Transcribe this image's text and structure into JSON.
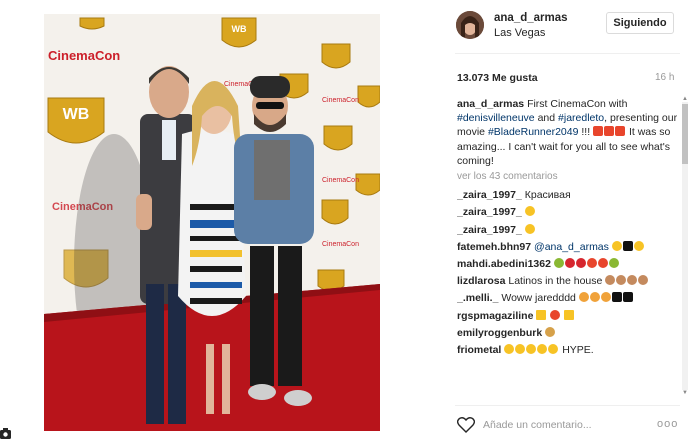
{
  "post": {
    "username": "ana_d_armas",
    "location": "Las Vegas",
    "follow_label": "Siguiendo",
    "likes": "13.073 Me gusta",
    "age": "16 h",
    "caption_user": "ana_d_armas",
    "caption_parts": {
      "p1": "First CinemaCon with",
      "tag1": "#denisvilleneuve",
      "p2": "and",
      "tag2": "#jaredleto",
      "p3": ", presenting our movie",
      "tag3": "#BladeRunner2049",
      "p4": "!!!",
      "p5": "It was so amazing... I can't wait for you all to see what's coming!"
    },
    "view_comments": "ver los 43 comentarios",
    "add_comment_placeholder": "Añade un comentario...",
    "more_options": "ooo"
  },
  "comments": [
    {
      "user": "_zaira_1997_",
      "text": "Красивая"
    },
    {
      "user": "_zaira_1997_",
      "text": ""
    },
    {
      "user": "_zaira_1997_",
      "text": ""
    },
    {
      "user": "fatemeh.bhn97",
      "mention": "@ana_d_armas",
      "text": ""
    },
    {
      "user": "mahdi.abedini1362",
      "text": ""
    },
    {
      "user": "lizdlarosa",
      "text": "Latinos in the house"
    },
    {
      "user": "_.melli._",
      "text": "Woww jaredddd"
    },
    {
      "user": "rgspmagaziline",
      "text": ""
    },
    {
      "user": "emilyroggenburk",
      "text": ""
    },
    {
      "user": "friometal",
      "text": "HYPE."
    }
  ],
  "photo": {
    "backdrop_brand": "CinemaCon",
    "logo_text": "WB",
    "backdrop_small": "CinemaCon"
  },
  "colors": {
    "link": "#003569",
    "muted": "#999999",
    "gold": "#d9a520",
    "carpet": "#b8141b"
  },
  "icons": {
    "heart": "heart-outline-icon",
    "side": "instagram-camera-icon"
  }
}
